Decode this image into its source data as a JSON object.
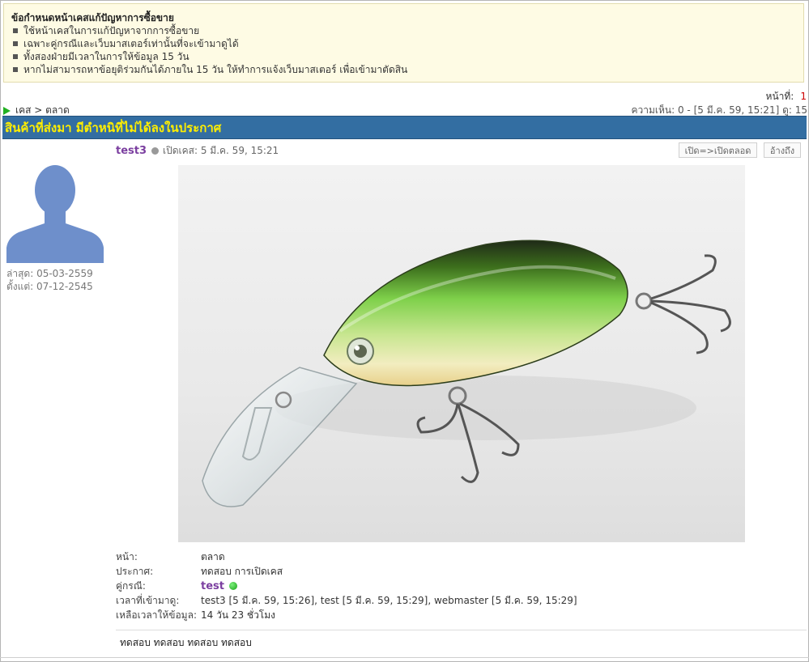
{
  "notice": {
    "title": "ข้อกำหนดหน้าเคสแก้ปัญหาการซื้อขาย",
    "items": [
      "ใช้หน้าเคสในการแก้ปัญหาจากการซื้อขาย",
      "เฉพาะคู่กรณีและเว็บมาสเตอร์เท่านั้นที่จะเข้ามาดูได้",
      "ทั้งสองฝ่ายมีเวลาในการให้ข้อมูล 15 วัน",
      "หากไม่สามารถหาข้อยุติร่วมกันได้ภายใน 15 วัน ให้ทำการแจ้งเว็บมาสเตอร์ เพื่อเข้ามาตัดสิน"
    ]
  },
  "pager": {
    "label": "หน้าที่:",
    "current": "1"
  },
  "breadcrumb": {
    "text": "เคส > ตลาด"
  },
  "stats": {
    "text": "ความเห็น: 0 - [5 มี.ค. 59, 15:21] ดู: 15"
  },
  "case": {
    "title": "สินค้าที่ส่งมา มีตำหนิที่ไม่ได้ลงในประกาศ",
    "poster": "test3",
    "opened": "เปิดเคส: 5 มี.ค. 59, 15:21",
    "open_button": "เปิด=>เปิดตลอด",
    "quote_button": "อ้างถึง",
    "body": "ทดสอบ ทดสอบ ทดสอบ ทดสอบ"
  },
  "profile": {
    "last": "ล่าสุด: 05-03-2559",
    "since": "ตั้งแต่: 07-12-2545"
  },
  "details": {
    "page_label": "หน้า:",
    "page_value": "ตลาด",
    "post_label": "ประกาศ:",
    "post_value": "ทดสอบ การเปิดเคส",
    "party_label": "คู่กรณี:",
    "party_value": "test",
    "visits_label": "เวลาที่เข้ามาดู:",
    "visits_value": "test3 [5 มี.ค. 59, 15:26], test [5 มี.ค. 59, 15:29], webmaster [5 มี.ค. 59, 15:29]",
    "remaining_label": "เหลือเวลาให้ข้อมูล:",
    "remaining_value": "14 วัน 23 ชั่วโมง"
  },
  "colors": {
    "title_bar": "#336ea2",
    "title_text": "#ffee00",
    "username": "#7b3fa0",
    "online": "#15a015"
  }
}
